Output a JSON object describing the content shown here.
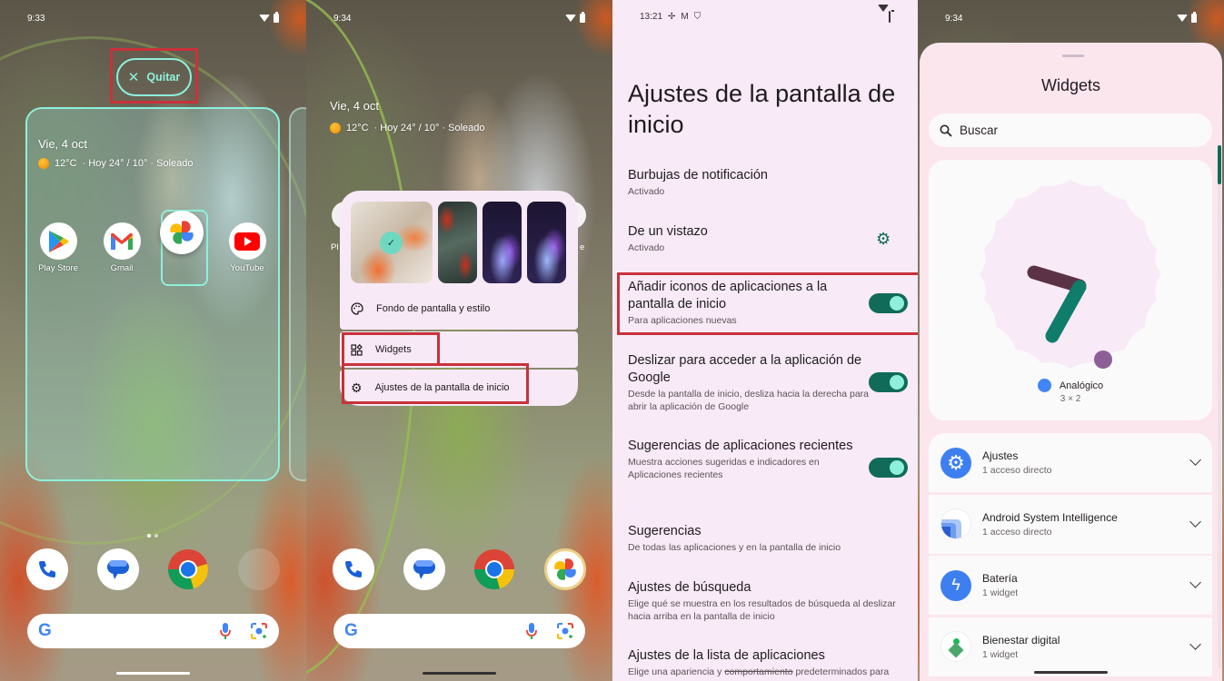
{
  "panel1": {
    "status": {
      "time": "9:33"
    },
    "remove_button": {
      "label": "Quitar",
      "icon": "close-icon"
    },
    "widget": {
      "date": "Vie, 4 oct",
      "temp": "12°C",
      "forecast": "· Hoy 24° / 10° · Soleado"
    },
    "apps": [
      {
        "label": "Play Store",
        "icon": "play-store-icon"
      },
      {
        "label": "Gmail",
        "icon": "gmail-icon"
      },
      {
        "label": "",
        "icon": "google-photos-icon",
        "dragging": true
      },
      {
        "label": "YouTube",
        "icon": "youtube-icon"
      }
    ],
    "page_indicator": {
      "pages": 2,
      "current": 1
    },
    "dock": [
      "phone-icon",
      "messages-icon",
      "chrome-icon",
      "empty-slot"
    ],
    "search": {
      "icons": [
        "google-g-icon",
        "mic-icon",
        "lens-icon"
      ]
    }
  },
  "panel2": {
    "status": {
      "time": "9:34"
    },
    "widget": {
      "date": "Vie, 4 oct",
      "temp": "12°C",
      "forecast": "· Hoy 24° / 10° · Soleado"
    },
    "wallpapers": [
      {
        "name": "wallpaper-current",
        "selected": true
      },
      {
        "name": "wallpaper-2",
        "selected": false
      },
      {
        "name": "wallpaper-3",
        "selected": false
      },
      {
        "name": "wallpaper-4",
        "selected": false
      }
    ],
    "menu": [
      {
        "label": "Fondo de pantalla y estilo",
        "icon": "palette-icon"
      },
      {
        "label": "Widgets",
        "icon": "widgets-icon"
      },
      {
        "label": "Ajustes de la pantalla de inicio",
        "icon": "gear-icon"
      }
    ],
    "partial_labels": {
      "left": "Pl",
      "right": "e"
    },
    "dock": [
      "phone-icon",
      "messages-icon",
      "chrome-icon",
      "google-photos-icon"
    ]
  },
  "panel3": {
    "status": {
      "time": "13:21"
    },
    "title": "Ajustes de la pantalla de inicio",
    "settings": [
      {
        "title": "Burbujas de notificación",
        "subtitle": "Activado"
      },
      {
        "title": "De un vistazo",
        "subtitle": "Activado",
        "gear": true
      },
      {
        "title": "Añadir iconos de aplicaciones a la pantalla de inicio",
        "subtitle": "Para aplicaciones nuevas",
        "toggle": true
      },
      {
        "title": "Deslizar para acceder a la aplicación de Google",
        "subtitle": "Desde la pantalla de inicio, desliza hacia la derecha para abrir la aplicación de Google",
        "toggle": true
      },
      {
        "title": "Sugerencias de aplicaciones recientes",
        "subtitle": "Muestra acciones sugeridas e indicadores en Aplicaciones recientes",
        "toggle": true
      },
      {
        "title": "Sugerencias",
        "subtitle": "De todas las aplicaciones y en la pantalla de inicio"
      },
      {
        "title": "Ajustes de búsqueda",
        "subtitle": "Elige qué se muestra en los resultados de búsqueda al deslizar hacia arriba en la pantalla de inicio"
      },
      {
        "title": "Ajustes de la lista de aplicaciones",
        "subtitle_pre": "Elige una apariencia y ",
        "subtitle_strike": "comportamiento",
        "subtitle_post": " predeterminados para"
      }
    ]
  },
  "panel4": {
    "status": {
      "time": "9:34"
    },
    "title": "Widgets",
    "search_placeholder": "Buscar",
    "preview": {
      "name": "Analógico",
      "size": "3 × 2"
    },
    "apps": [
      {
        "name": "Ajustes",
        "count": "1 acceso directo",
        "icon": "settings-app-icon"
      },
      {
        "name": "Android System Intelligence",
        "count": "1 acceso directo",
        "icon": "asi-app-icon"
      },
      {
        "name": "Batería",
        "count": "1 widget",
        "icon": "battery-app-icon"
      },
      {
        "name": "Bienestar digital",
        "count": "1 widget",
        "icon": "digital-wellbeing-icon"
      }
    ]
  },
  "colors": {
    "accent": "#8ef0dc",
    "highlight": "#c8323a",
    "toggle_track": "#116b58",
    "surface": "#f8eaf6"
  }
}
